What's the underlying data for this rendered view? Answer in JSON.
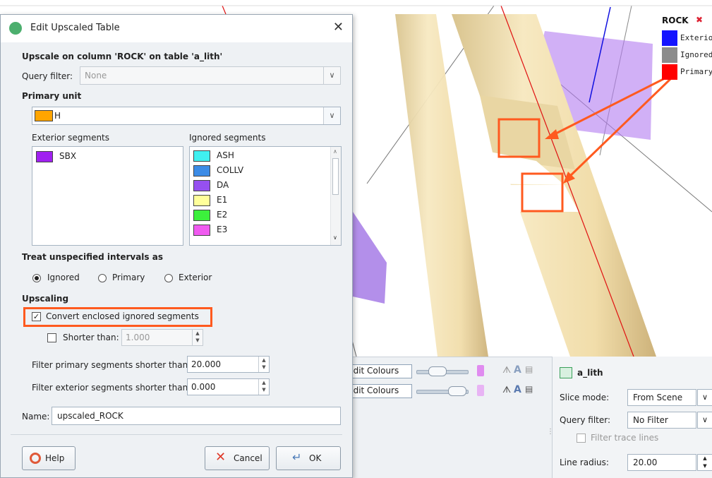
{
  "legend": {
    "title": "ROCK",
    "close_glyph": "✖",
    "items": [
      {
        "label": "Exterior",
        "color": "#1414ff"
      },
      {
        "label": "Ignored",
        "color": "#8c8c8c"
      },
      {
        "label": "Primary",
        "color": "#ff0000"
      }
    ]
  },
  "bottom_rows": [
    {
      "edit_label": "Edit Colours"
    },
    {
      "edit_label": "Edit Colours"
    }
  ],
  "props": {
    "object_name": "a_lith",
    "slice_mode_label": "Slice mode:",
    "slice_mode_value": "From Scene",
    "query_filter_label": "Query filter:",
    "query_filter_value": "No Filter",
    "filter_trace_label": "Filter trace lines",
    "line_radius_label": "Line radius:",
    "line_radius_value": "20.00"
  },
  "dialog": {
    "title": "Edit Upscaled Table",
    "close_glyph": "✕",
    "heading": "Upscale on column 'ROCK' on table 'a_lith'",
    "query_filter_label": "Query filter:",
    "query_filter_value": "None",
    "primary_unit_label": "Primary unit",
    "primary_unit_value": "H",
    "primary_unit_color": "#ffa500",
    "exterior_label": "Exterior segments",
    "ignored_label": "Ignored segments",
    "exterior_items": [
      {
        "label": "SBX",
        "color": "#a020f0"
      }
    ],
    "ignored_items": [
      {
        "label": "ASH",
        "color": "#40f0f0"
      },
      {
        "label": "COLLV",
        "color": "#3c8ce6"
      },
      {
        "label": "DA",
        "color": "#9650f0"
      },
      {
        "label": "E1",
        "color": "#ffff9a"
      },
      {
        "label": "E2",
        "color": "#3cf03c"
      },
      {
        "label": "E3",
        "color": "#f05af0"
      }
    ],
    "treat_label": "Treat unspecified intervals as",
    "radio_ignored": "Ignored",
    "radio_primary": "Primary",
    "radio_exterior": "Exterior",
    "upscaling_label": "Upscaling",
    "convert_label": "Convert enclosed ignored segments",
    "shorter_label": "Shorter than:",
    "shorter_value": "1.000",
    "filter_primary_label": "Filter primary segments shorter than:",
    "filter_primary_value": "20.000",
    "filter_exterior_label": "Filter exterior segments shorter than:",
    "filter_exterior_value": "0.000",
    "name_label": "Name:",
    "name_value": "upscaled_ROCK",
    "help_label": "Help",
    "cancel_label": "Cancel",
    "ok_label": "OK"
  }
}
